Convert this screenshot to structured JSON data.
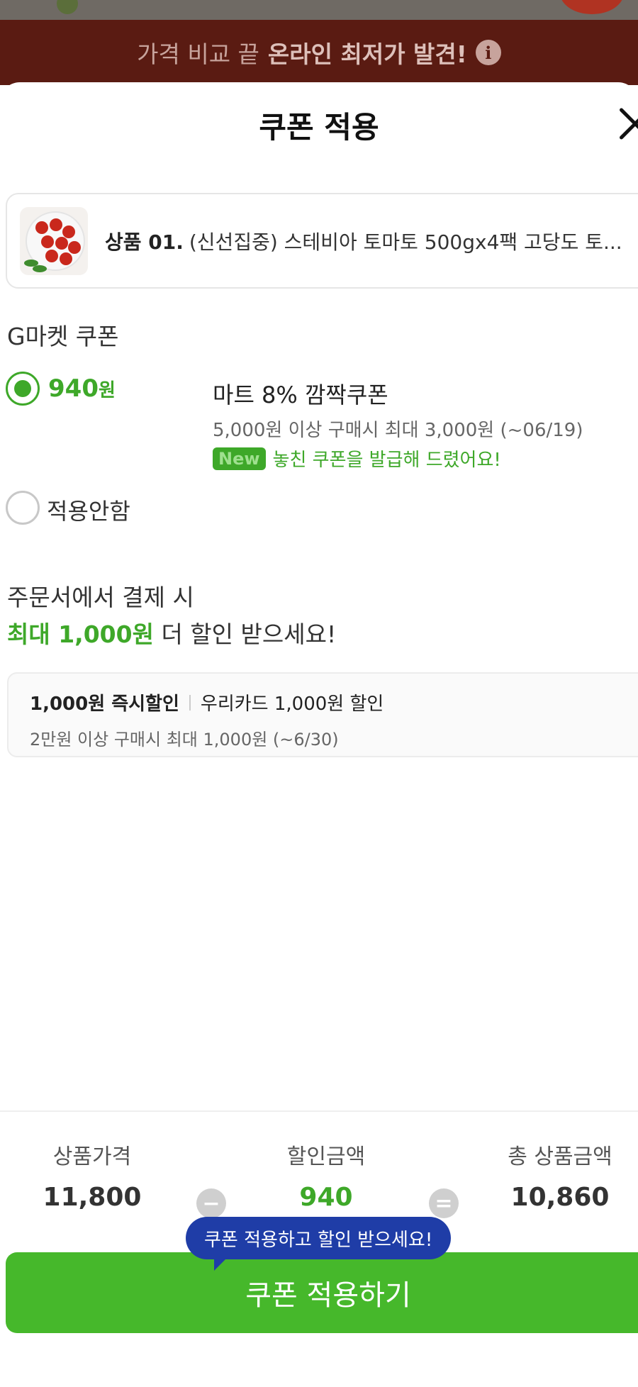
{
  "banner": {
    "text_prefix": "가격 비교 끝",
    "text_bold": "온라인 최저가 발견!",
    "info_icon": "info-icon"
  },
  "sheet": {
    "title": "쿠폰 적용",
    "close_icon": "close-icon"
  },
  "product": {
    "index_label": "상품 01.",
    "name": "(신선집중) 스테비아 토마토 500gx4팩 고당도 토..."
  },
  "coupon_section": {
    "title": "G마켓 쿠폰",
    "options": [
      {
        "amount": "940",
        "unit": "원",
        "selected": true,
        "name": "마트 8% 깜짝쿠폰",
        "condition": "5,000원 이상 구매시 최대 3,000원 (~06/19)",
        "badge": "New",
        "notice": "놓친 쿠폰을 발급해 드렸어요!"
      },
      {
        "label": "적용안함",
        "selected": false
      }
    ]
  },
  "payment_benefit": {
    "line1": "주문서에서 결제 시",
    "line2_highlight": "최대 1,000원",
    "line2_rest": " 더 할인 받으세요!",
    "card": {
      "title": "1,000원 즉시할인",
      "desc": "우리카드 1,000원 할인",
      "condition": "2만원 이상 구매시 최대 1,000원 (~6/30)"
    }
  },
  "summary": {
    "price_label": "상품가격",
    "price_value": "11,800",
    "minus_symbol": "−",
    "discount_label": "할인금액",
    "discount_value": "940",
    "equals_symbol": "=",
    "total_label": "총 상품금액",
    "total_value": "10,860"
  },
  "tooltip": "쿠폰 적용하고 할인 받으세요!",
  "apply_button": "쿠폰 적용하기",
  "colors": {
    "accent_green": "#3ea829",
    "button_green": "#46b82b",
    "tooltip_blue": "#1f3da7",
    "banner_bg": "#5a1b12"
  }
}
